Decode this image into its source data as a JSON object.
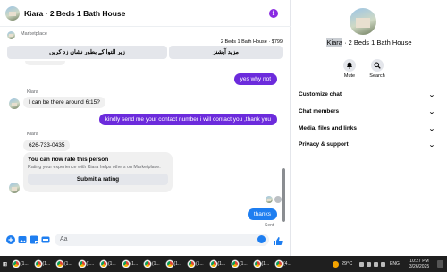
{
  "header": {
    "title": "Kiara · 2 Beds 1 Bath House",
    "info_glyph": "i"
  },
  "marketplace": {
    "label": "Marketplace",
    "listing": "2 Beds 1 Bath House · $799",
    "button_left": "زیر التوا کے بطور نشان زد کریں",
    "button_right": "مزید آپشنز"
  },
  "messages": [
    {
      "id": "m1",
      "dir": "out",
      "text": "yes why not"
    },
    {
      "id": "m2",
      "dir": "in",
      "sender": "Kiara",
      "text": "I can be there around 6:15?"
    },
    {
      "id": "m3",
      "dir": "out",
      "text": "kindly send me your contact number  i will contact you ,thank you"
    },
    {
      "id": "m4",
      "dir": "in",
      "sender": "Kiara",
      "text": "626-733-0435"
    },
    {
      "id": "m5",
      "dir": "out",
      "text": "thanks",
      "status": "Sent"
    }
  ],
  "rating": {
    "title": "You can now rate this person",
    "description": "Rating your experience with Kiara helps others on Marketplace.",
    "button": "Submit a rating"
  },
  "composer": {
    "placeholder": "Aa",
    "icons": [
      "plus-circle-icon",
      "image-icon",
      "sticker-icon",
      "gif-icon",
      "emoji-icon",
      "thumbs-up-icon"
    ]
  },
  "info_panel": {
    "name_highlight": "Kiara",
    "name_rest": " · 2 Beds 1 Bath House",
    "actions": [
      {
        "label": "Mute",
        "icon": "bell-icon"
      },
      {
        "label": "Search",
        "icon": "search-icon"
      }
    ],
    "sections": [
      "Customize chat",
      "Chat members",
      "Media, files and links",
      "Privacy & support"
    ]
  },
  "taskbar": {
    "weather": "29°C",
    "language": "ENG",
    "time": "10:27 PM",
    "date": "3/26/2025",
    "badges": [
      "(1...",
      "(1...",
      "(1...",
      "(1...",
      "(1...",
      "(1...",
      "(1...",
      "(1...",
      "(1...",
      "(1...",
      "(1...",
      "(1...",
      "(4..."
    ],
    "accent": "#f4a300"
  },
  "colors": {
    "outgoing_bubble": "#6c2bdc",
    "last_bubble": "#1e7ef0",
    "incoming_bubble": "#f0f0f0",
    "info_icon": "#8a2be2"
  }
}
